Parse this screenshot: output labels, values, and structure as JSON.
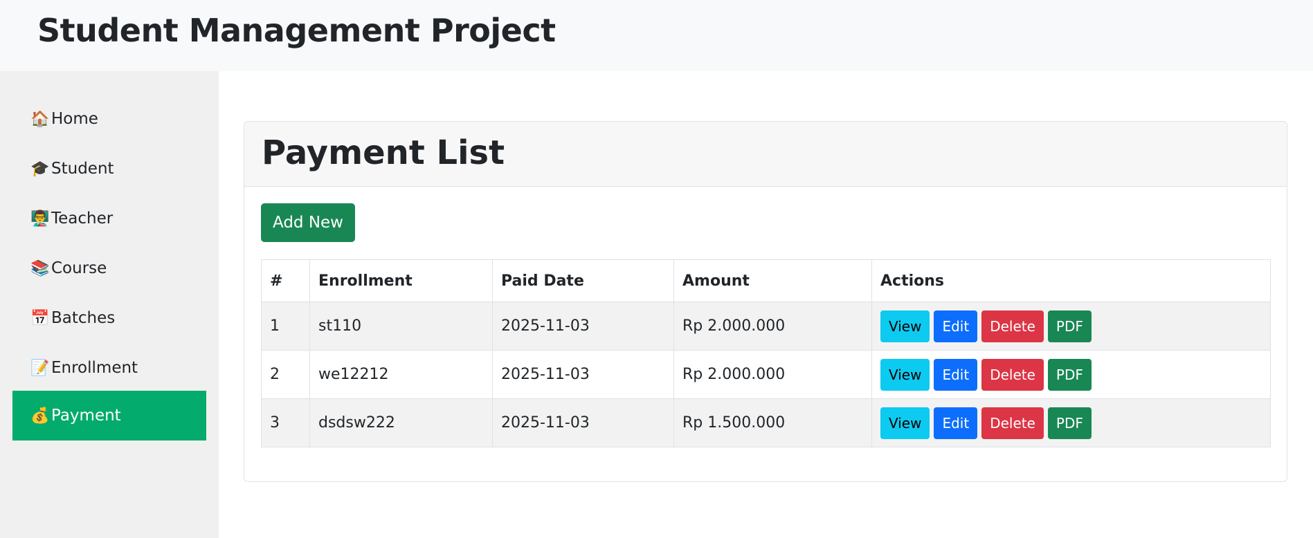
{
  "app": {
    "title": "Student Management Project"
  },
  "sidebar": {
    "items": [
      {
        "icon": "🏠",
        "label": "Home",
        "active": false
      },
      {
        "icon": "🎓",
        "label": "Student",
        "active": false
      },
      {
        "icon": "👨‍🏫",
        "label": "Teacher",
        "active": false
      },
      {
        "icon": "📚",
        "label": "Course",
        "active": false
      },
      {
        "icon": "📅",
        "label": "Batches",
        "active": false
      },
      {
        "icon": "📝",
        "label": "Enrollment",
        "active": false
      },
      {
        "icon": "💰",
        "label": "Payment",
        "active": true
      }
    ],
    "active_color": "#03ab6c"
  },
  "main": {
    "title": "Payment List",
    "add_label": "Add New",
    "table": {
      "headers": [
        "#",
        "Enrollment",
        "Paid Date",
        "Amount",
        "Actions"
      ],
      "rows": [
        {
          "num": "1",
          "enrollment": "st110",
          "paid_date": "2025-11-03",
          "amount": "Rp 2.000.000"
        },
        {
          "num": "2",
          "enrollment": "we12212",
          "paid_date": "2025-11-03",
          "amount": "Rp 2.000.000"
        },
        {
          "num": "3",
          "enrollment": "dsdsw222",
          "paid_date": "2025-11-03",
          "amount": "Rp 1.500.000"
        }
      ],
      "actions": {
        "view": "View",
        "edit": "Edit",
        "delete": "Delete",
        "pdf": "PDF"
      }
    }
  }
}
